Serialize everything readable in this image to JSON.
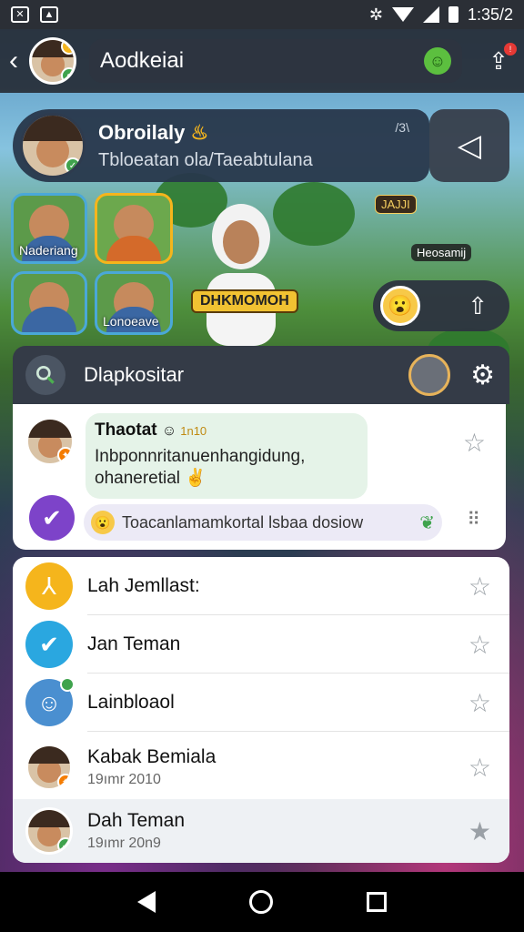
{
  "status_bar": {
    "time": "1:35/2"
  },
  "header": {
    "title": "Aodkeiai"
  },
  "featured": {
    "title": "Obroilaly",
    "subtitle": "Tbloeatan ola/Taeabtulana",
    "meta": "/3\\"
  },
  "stories": {
    "tile1_label": "Naderiang",
    "tile3_label": "Lonoeave",
    "hero_banner": "DHKMOMOH",
    "right_tag": "JAJJI",
    "right_label": "Heosamij"
  },
  "search": {
    "placeholder": "Dlapkositar"
  },
  "chat": {
    "sender": "Thaotat",
    "sender_tag": "1n10",
    "message": "Inbponnritanuenhangidung, ohaneretial",
    "sub_message": "Toacanlamamkortal lsbaa dosiow"
  },
  "list": {
    "items": [
      {
        "name": "Lah Jemllast:",
        "time": ""
      },
      {
        "name": "Jan Teman",
        "time": ""
      },
      {
        "name": "Lainbloaol",
        "time": ""
      },
      {
        "name": "Kabak Bemiala",
        "time": "19ımr 2010"
      },
      {
        "name": "Dah Teman",
        "time": "19ımr 20n9"
      }
    ]
  },
  "colors": {
    "accent_purple": "#7d43c9",
    "accent_yellow": "#f5b51c",
    "accent_blue": "#2aa7e0",
    "bubble_green": "#e5f3e8"
  }
}
